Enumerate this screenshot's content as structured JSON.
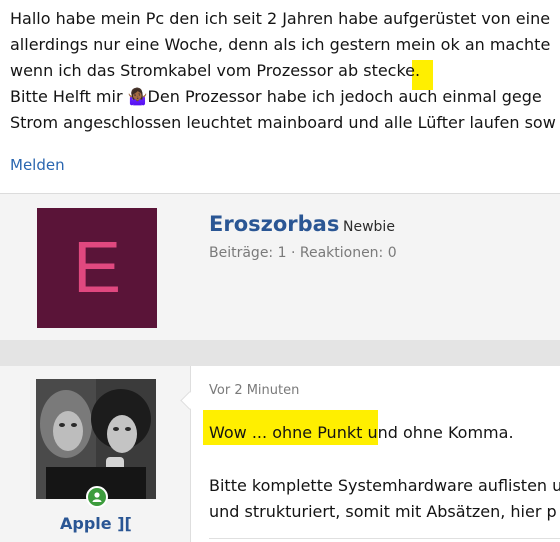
{
  "first_post": {
    "lines": [
      "Hallo habe mein Pc den ich seit 2 Jahren habe aufgerüstet von eine",
      "allerdings nur eine Woche, denn als ich gestern mein ok an machte",
      "wenn ich das Stromkabel vom Prozessor ab stecke.",
      "Bitte Helft mir 🤷🏾‍♀️Den Prozessor habe ich jedoch auch einmal gege",
      "Strom angeschlossen leuchtet mainboard und alle Lüfter laufen sow"
    ],
    "report_label": "Melden"
  },
  "author": {
    "avatar_letter": "E",
    "name": "Eroszorbas",
    "role": "Newbie",
    "stats": "Beiträge: 1 · Reaktionen: 0"
  },
  "reply": {
    "time": "Vor 2 Minuten",
    "line1": "Wow ... ohne Punkt und ohne Komma.",
    "line2": "Bitte komplette Systemhardware auflisten u",
    "line3": "und strukturiert, somit mit Absätzen, hier p",
    "username": "Apple ]["
  },
  "colors": {
    "highlight": "#ffef00",
    "link": "#2a66b0",
    "avatar_bg": "#5a1438",
    "avatar_letter": "#e0487f",
    "online": "#3d9c3d"
  }
}
